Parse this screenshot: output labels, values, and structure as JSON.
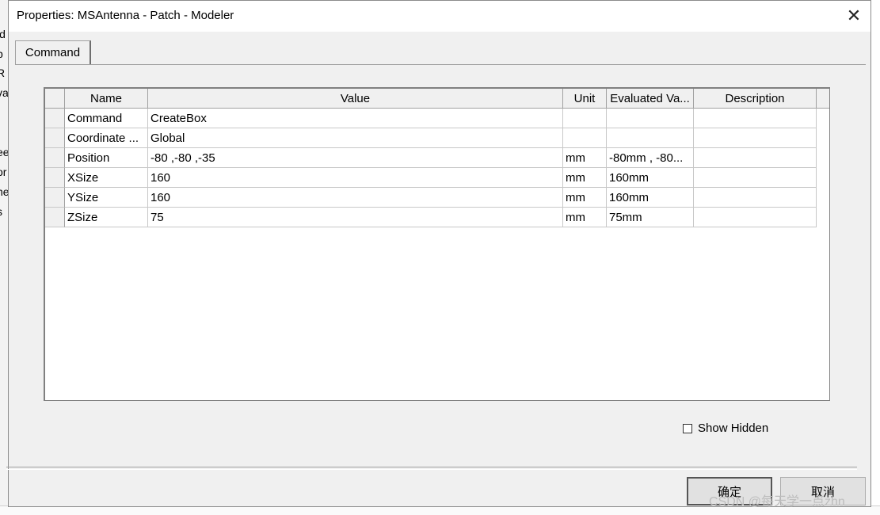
{
  "dialog": {
    "title": "Properties: MSAntenna - Patch - Modeler",
    "close_glyph": "✕"
  },
  "tabs": [
    {
      "label": "Command"
    }
  ],
  "grid": {
    "headers": {
      "name": "Name",
      "value": "Value",
      "unit": "Unit",
      "evaluated": "Evaluated Va...",
      "description": "Description"
    },
    "rows": [
      {
        "name": "Command",
        "value": "CreateBox",
        "unit": "",
        "evaluated": "",
        "description": ""
      },
      {
        "name": "Coordinate ...",
        "value": "Global",
        "unit": "",
        "evaluated": "",
        "description": ""
      },
      {
        "name": "Position",
        "value": "-80 ,-80 ,-35",
        "unit": "mm",
        "evaluated": "-80mm , -80...",
        "description": ""
      },
      {
        "name": "XSize",
        "value": "160",
        "unit": "mm",
        "evaluated": "160mm",
        "description": ""
      },
      {
        "name": "YSize",
        "value": "160",
        "unit": "mm",
        "evaluated": "160mm",
        "description": ""
      },
      {
        "name": "ZSize",
        "value": "75",
        "unit": "mm",
        "evaluated": "75mm",
        "description": ""
      }
    ]
  },
  "show_hidden": {
    "label": "Show Hidden",
    "checked": false
  },
  "buttons": {
    "ok": "确定",
    "cancel": "取消"
  },
  "watermark": "CSDN @每天学一点zhn",
  "background_fragments": [
    "id",
    "p",
    "R",
    "va",
    "ee",
    "or",
    "ne",
    "s"
  ]
}
